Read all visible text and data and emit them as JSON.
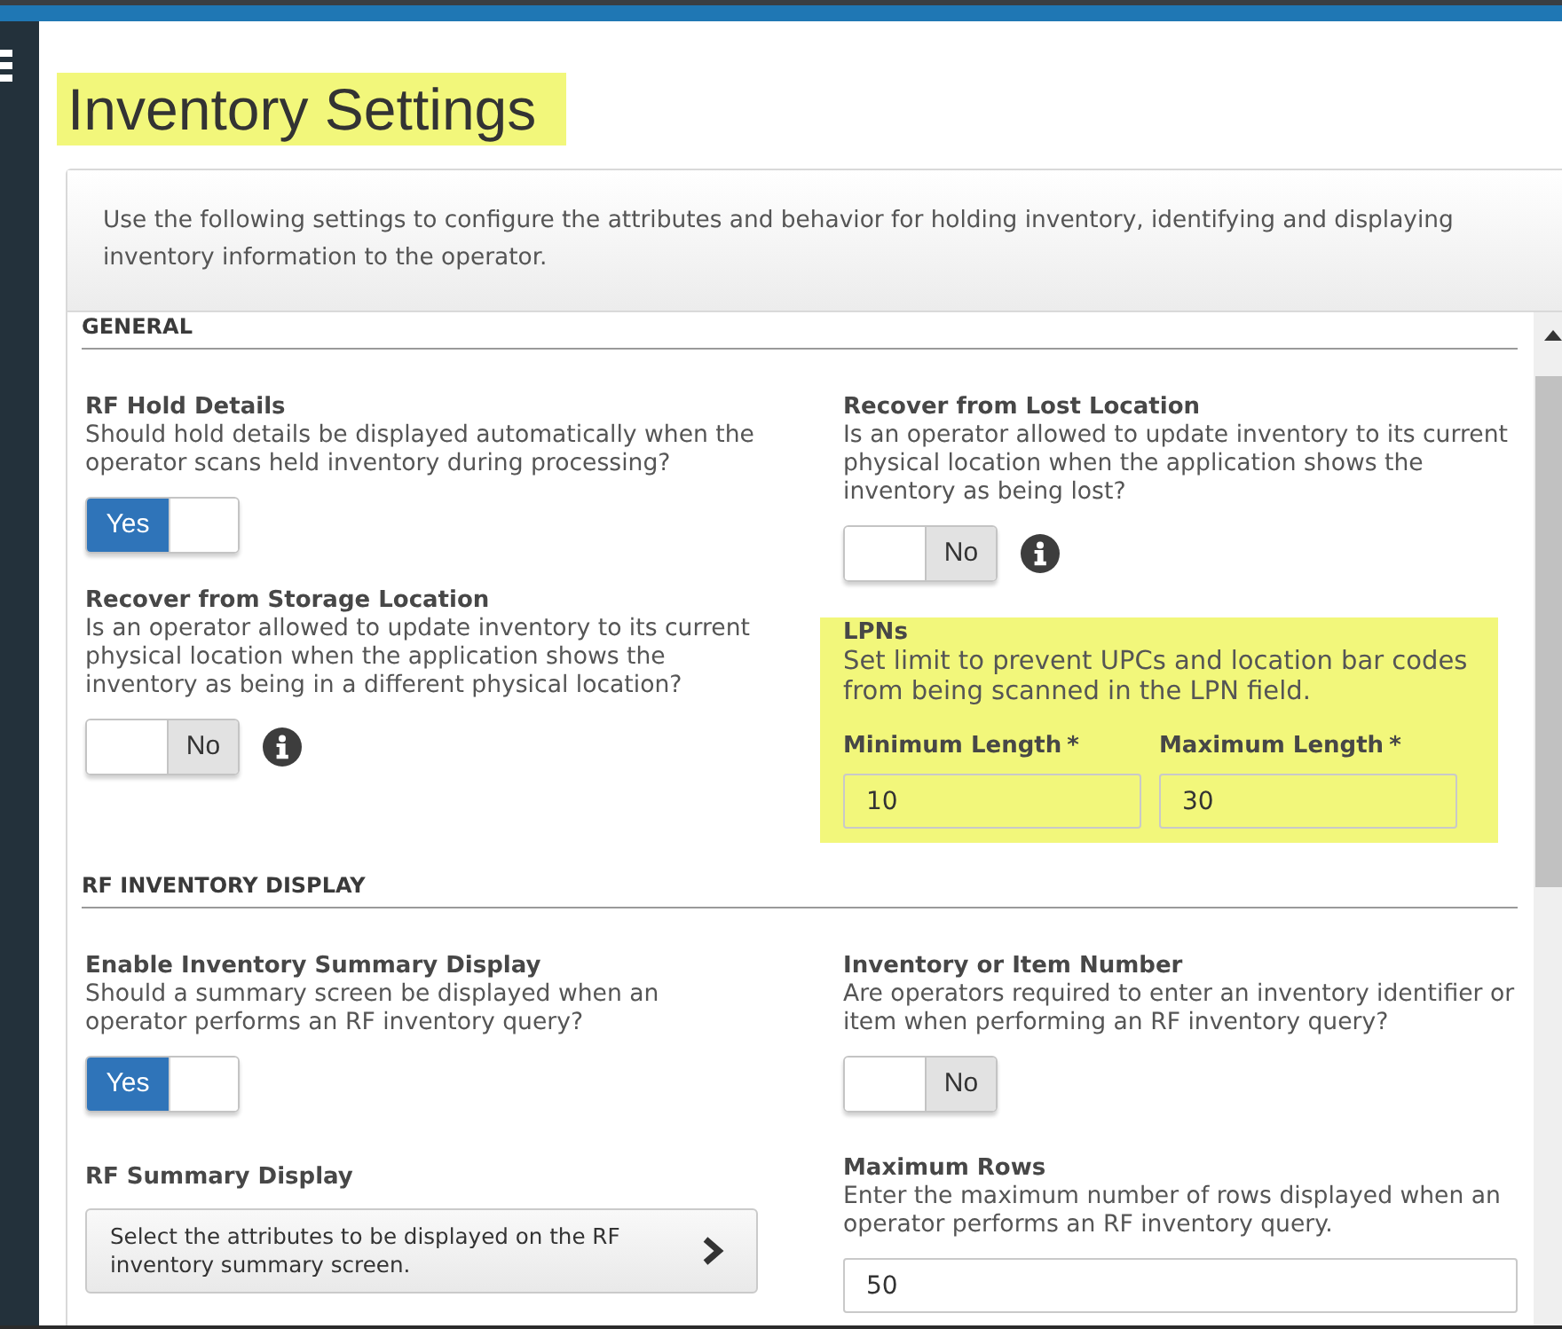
{
  "page": {
    "title": "Inventory Settings",
    "highlighted": true
  },
  "intro": "Use the following settings to configure the attributes and behavior for holding inventory, identifying and displaying inventory information to the operator.",
  "sections": [
    {
      "heading": "GENERAL",
      "columns": [
        [
          {
            "kind": "toggle",
            "title": "RF Hold Details",
            "description": "Should hold details be displayed automatically when the operator scans held inventory during processing?",
            "on": true,
            "label": "Yes",
            "info": false
          },
          {
            "kind": "toggle",
            "title": "Recover from Storage Location",
            "description": "Is an operator allowed to update inventory to its current physical location when the application shows the inventory as being in a different physical location?",
            "on": false,
            "label": "No",
            "info": true
          }
        ],
        [
          {
            "kind": "toggle",
            "title": "Recover from Lost Location",
            "description": "Is an operator allowed to update inventory to its current physical location when the application shows the inventory as being lost?",
            "on": false,
            "label": "No",
            "info": true
          },
          {
            "kind": "limits",
            "title": "LPNs",
            "description": "Set limit to prevent UPCs and location bar codes from being scanned in the LPN field.",
            "highlighted": true,
            "fields": [
              {
                "label": "Minimum Length",
                "required_mark": "*",
                "value": "10"
              },
              {
                "label": "Maximum Length",
                "required_mark": "*",
                "value": "30"
              }
            ]
          }
        ]
      ]
    },
    {
      "heading": "RF INVENTORY DISPLAY",
      "columns": [
        [
          {
            "kind": "toggle",
            "title": "Enable Inventory Summary Display",
            "description": "Should a summary screen be displayed when an operator performs an RF inventory query?",
            "on": true,
            "label": "Yes",
            "info": false
          },
          {
            "kind": "link",
            "title": "RF Summary Display",
            "button": "Select the attributes to be displayed on the RF inventory summary screen."
          }
        ],
        [
          {
            "kind": "toggle",
            "title": "Inventory or Item Number",
            "description": "Are operators required to enter an inventory identifier or item when performing an RF inventory query?",
            "on": false,
            "label": "No",
            "info": false
          },
          {
            "kind": "number",
            "title": "Maximum Rows",
            "description": "Enter the maximum number of rows displayed when an operator performs an RF inventory query.",
            "value": "50"
          }
        ]
      ]
    }
  ]
}
